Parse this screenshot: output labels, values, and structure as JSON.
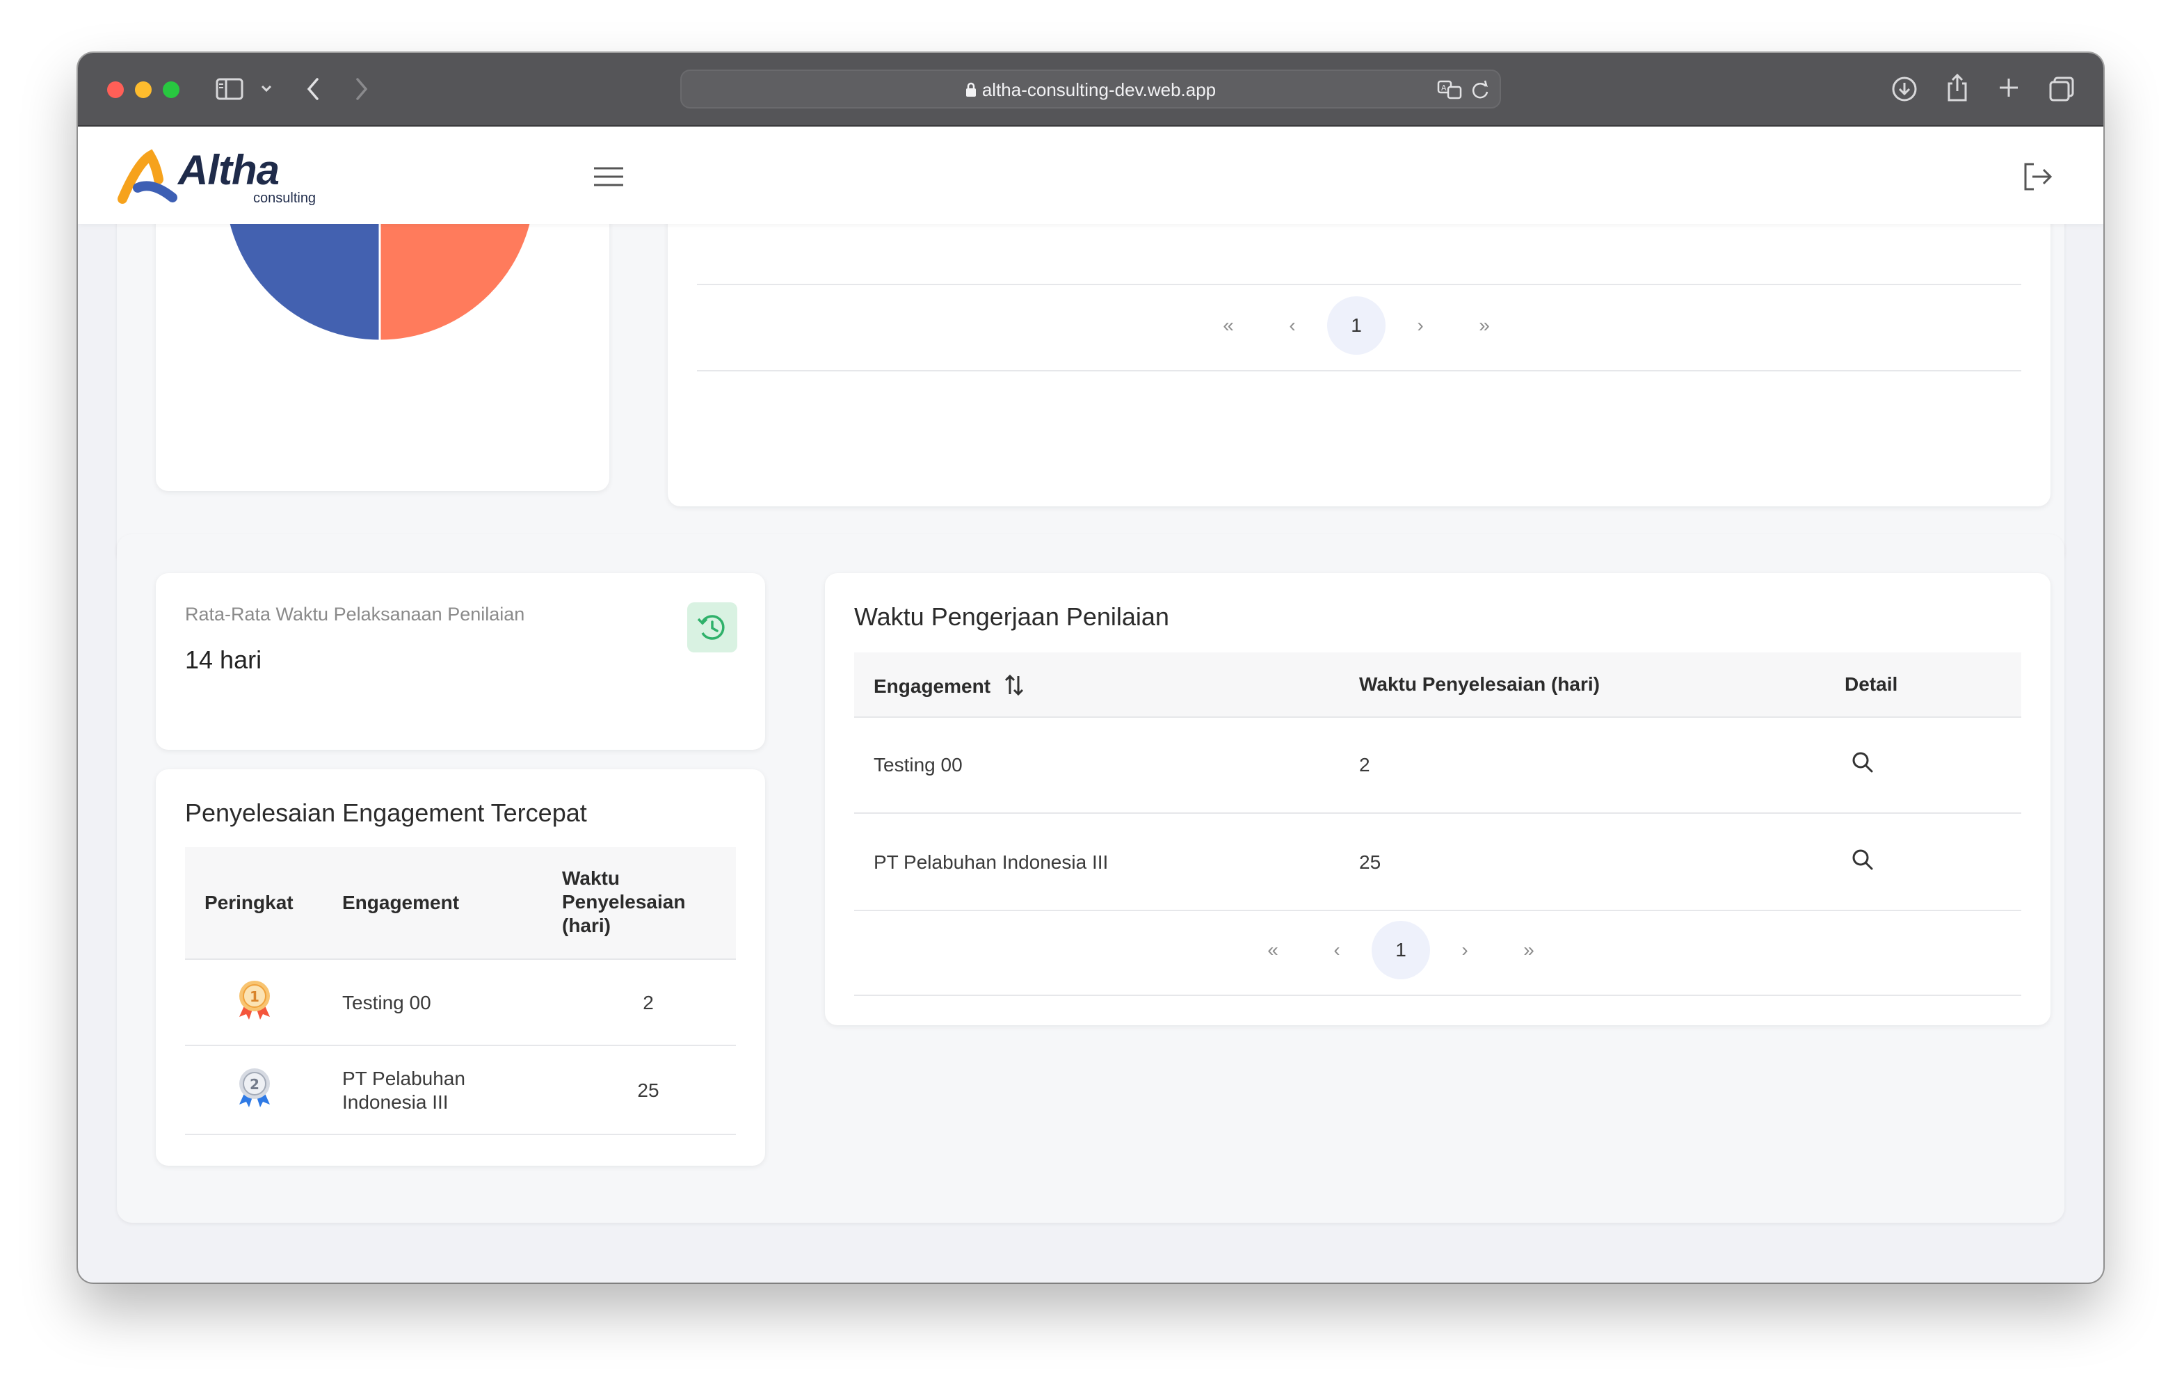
{
  "browser": {
    "url": "altha-consulting-dev.web.app"
  },
  "app": {
    "logo_text": "Altha",
    "logo_sub": "consulting"
  },
  "pie_chart": {
    "chart_data": {
      "type": "pie",
      "values": [
        50,
        50
      ],
      "colors": [
        "#4361b0",
        "#ff7b5c"
      ]
    }
  },
  "top_table": {
    "pagination": {
      "first": "«",
      "prev": "‹",
      "current": "1",
      "next": "›",
      "last": "»"
    }
  },
  "avg_card": {
    "label": "Rata-Rata Waktu Pelaksanaan Penilaian",
    "value": "14 hari",
    "icon_color": "#2fb16a"
  },
  "fastest": {
    "title": "Penyelesaian Engagement Tercepat",
    "headers": {
      "rank": "Peringkat",
      "engagement": "Engagement",
      "time_line1": "Waktu",
      "time_line2": "Penyelesaian",
      "time_line3": "(hari)"
    },
    "rows": [
      {
        "rank": "1",
        "engagement": "Testing 00",
        "time": "2"
      },
      {
        "rank": "2",
        "engagement_line1": "PT Pelabuhan",
        "engagement_line2": "Indonesia III",
        "time": "25"
      }
    ]
  },
  "work_time": {
    "title": "Waktu Pengerjaan Penilaian",
    "headers": {
      "engagement": "Engagement",
      "time": "Waktu Penyelesaian (hari)",
      "detail": "Detail"
    },
    "rows": [
      {
        "engagement": "Testing 00",
        "time": "2"
      },
      {
        "engagement": "PT Pelabuhan Indonesia III",
        "time": "25"
      }
    ],
    "pagination": {
      "first": "«",
      "prev": "‹",
      "current": "1",
      "next": "›",
      "last": "»"
    }
  }
}
